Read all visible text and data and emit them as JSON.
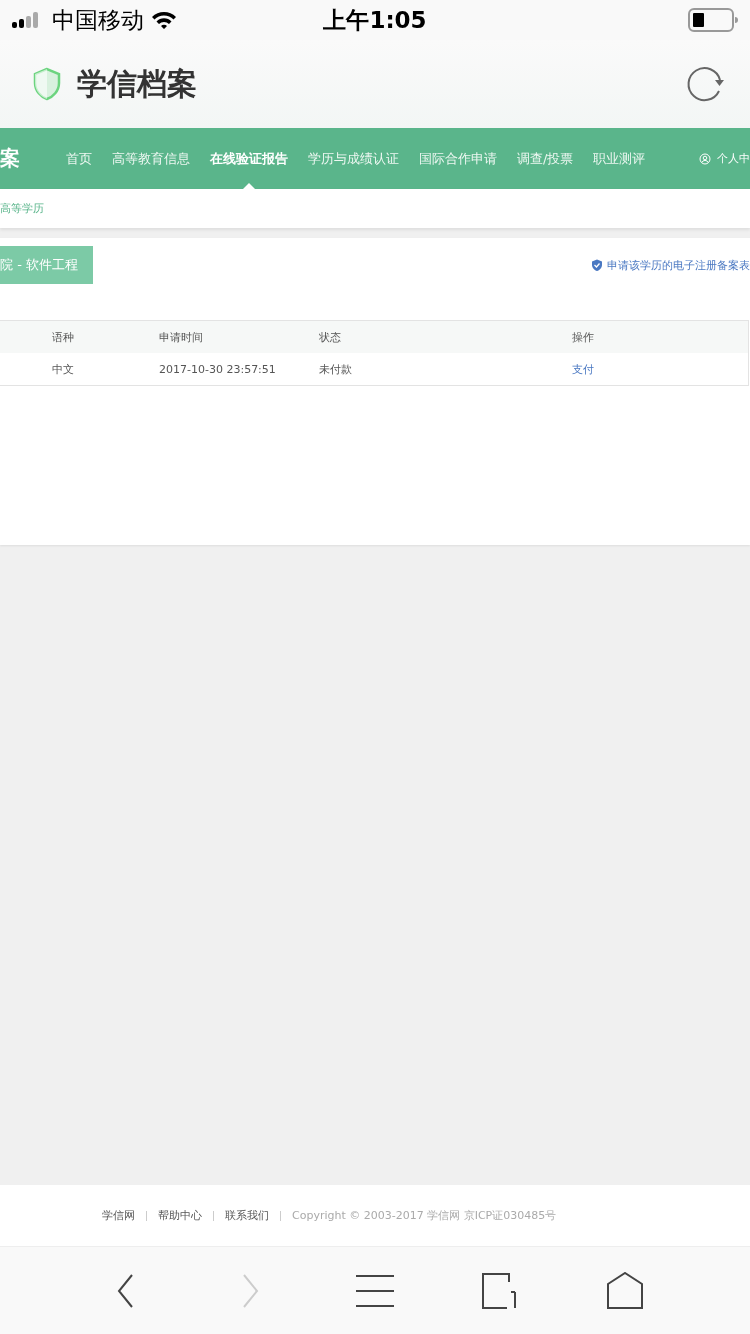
{
  "status_bar": {
    "carrier": "中国移动",
    "time": "上午1:05"
  },
  "app_header": {
    "title": "学信档案"
  },
  "nav": {
    "logo_text": "案",
    "items": [
      {
        "label": "首页",
        "selected": false
      },
      {
        "label": "高等教育信息",
        "selected": false
      },
      {
        "label": "在线验证报告",
        "selected": true
      },
      {
        "label": "学历与成绩认证",
        "selected": false
      },
      {
        "label": "国际合作申请",
        "selected": false
      },
      {
        "label": "调查/投票",
        "selected": false
      },
      {
        "label": "职业测评",
        "selected": false
      }
    ],
    "user_link": "个人中"
  },
  "breadcrumb": "高等学历",
  "record": {
    "title": "院 - 软件工程",
    "link": "申请该学历的电子注册备案表"
  },
  "table": {
    "columns": [
      "语种",
      "申请时间",
      "状态",
      "操作"
    ],
    "rows": [
      {
        "cells": [
          "中文",
          "2017-10-30 23:57:51",
          "未付款"
        ],
        "action": "支付"
      }
    ]
  },
  "footer": {
    "links": [
      "学信网",
      "帮助中心",
      "联系我们"
    ],
    "copyright": "Copyright © 2003-2017 学信网 京ICP证030485号"
  },
  "toolbar": [
    {
      "kind": "back",
      "disabled": false
    },
    {
      "kind": "forward",
      "disabled": true
    },
    {
      "kind": "menu",
      "disabled": false
    },
    {
      "kind": "tabs",
      "disabled": false
    },
    {
      "kind": "home",
      "disabled": false
    }
  ]
}
